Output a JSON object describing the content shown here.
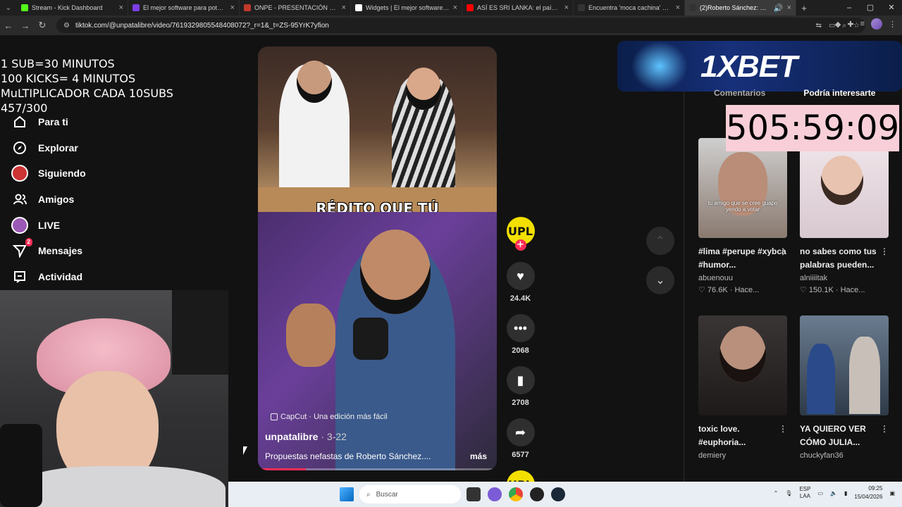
{
  "browser": {
    "tabs": [
      {
        "title": "Stream - Kick Dashboard",
        "color": "#53fc18",
        "active": false
      },
      {
        "title": "El mejor software para potencia",
        "color": "#7b3fe4",
        "active": false
      },
      {
        "title": "ONPE - PRESENTACIÓN DE RES",
        "color": "#c0392b",
        "active": false
      },
      {
        "title": "Widgets | El mejor software pa",
        "color": "#ffffff",
        "active": false
      },
      {
        "title": "ASÍ ES SRI LANKA: el país \"más",
        "color": "#ff0000",
        "active": false
      },
      {
        "title": "Encuentra 'moca cachina' en Tik",
        "color": "#111111",
        "active": false
      },
      {
        "title": "(2)Roberto Sánchez: Propu",
        "color": "#111111",
        "active": true
      }
    ],
    "url": "tiktok.com/@unpatalibre/video/7619329805548408072?_r=1&_t=ZS-95YrK7yfion"
  },
  "overlay": {
    "lines": [
      "1 SUB=30 MINUTOS",
      "100 KICKS= 4 MINUTOS",
      "MuLTIPLICADOR CADA 10SUBS",
      "457/300"
    ]
  },
  "sidenav": {
    "items": [
      {
        "label": "Para ti",
        "icon": "home-icon"
      },
      {
        "label": "Explorar",
        "icon": "compass-icon"
      },
      {
        "label": "Siguiendo",
        "icon": "following-avatar-icon"
      },
      {
        "label": "Amigos",
        "icon": "friends-icon"
      },
      {
        "label": "LIVE",
        "icon": "live-icon"
      },
      {
        "label": "Mensajes",
        "icon": "messages-icon",
        "badge": "2"
      },
      {
        "label": "Actividad",
        "icon": "activity-icon"
      }
    ]
  },
  "video": {
    "subtitle": "RÉDITO QUE TÚ",
    "capcut": "CapCut · Una edición más fácil",
    "author": "unpatalibre",
    "date": "3-22",
    "description": "Propuestas nefastas de Roberto Sánchez....",
    "more": "más",
    "progress": 0.2
  },
  "actions": {
    "avatar_text": "UPL",
    "likes": "24.4K",
    "comments": "2068",
    "saves": "2708",
    "shares": "6577"
  },
  "sponsor": {
    "logo": "1XBET"
  },
  "panel": {
    "tabs": [
      "Comentarios",
      "Podría interesarte"
    ]
  },
  "timer": "505:59:09",
  "recommendations": [
    {
      "caption": "#lima #perupe #xybca #humor...",
      "author": "abuenouu",
      "likes": "76.6K",
      "time": "Hace...",
      "overlay": "tu amigo que se cree guapo yendo a votar"
    },
    {
      "caption": "no sabes como tus palabras pueden...",
      "author": "alniiiitak",
      "likes": "150.1K",
      "time": "Hace..."
    },
    {
      "caption": "toxic love. #euphoria...",
      "author": "demiery",
      "likes": "",
      "time": ""
    },
    {
      "caption": "YA QUIERO VER CÓMO JULIA...",
      "author": "chuckyfan36",
      "likes": "",
      "time": ""
    }
  ],
  "taskbar": {
    "search_placeholder": "Buscar",
    "lang": "ESP",
    "lang2": "LAA",
    "time": "09:25",
    "date": "15/04/2026"
  }
}
